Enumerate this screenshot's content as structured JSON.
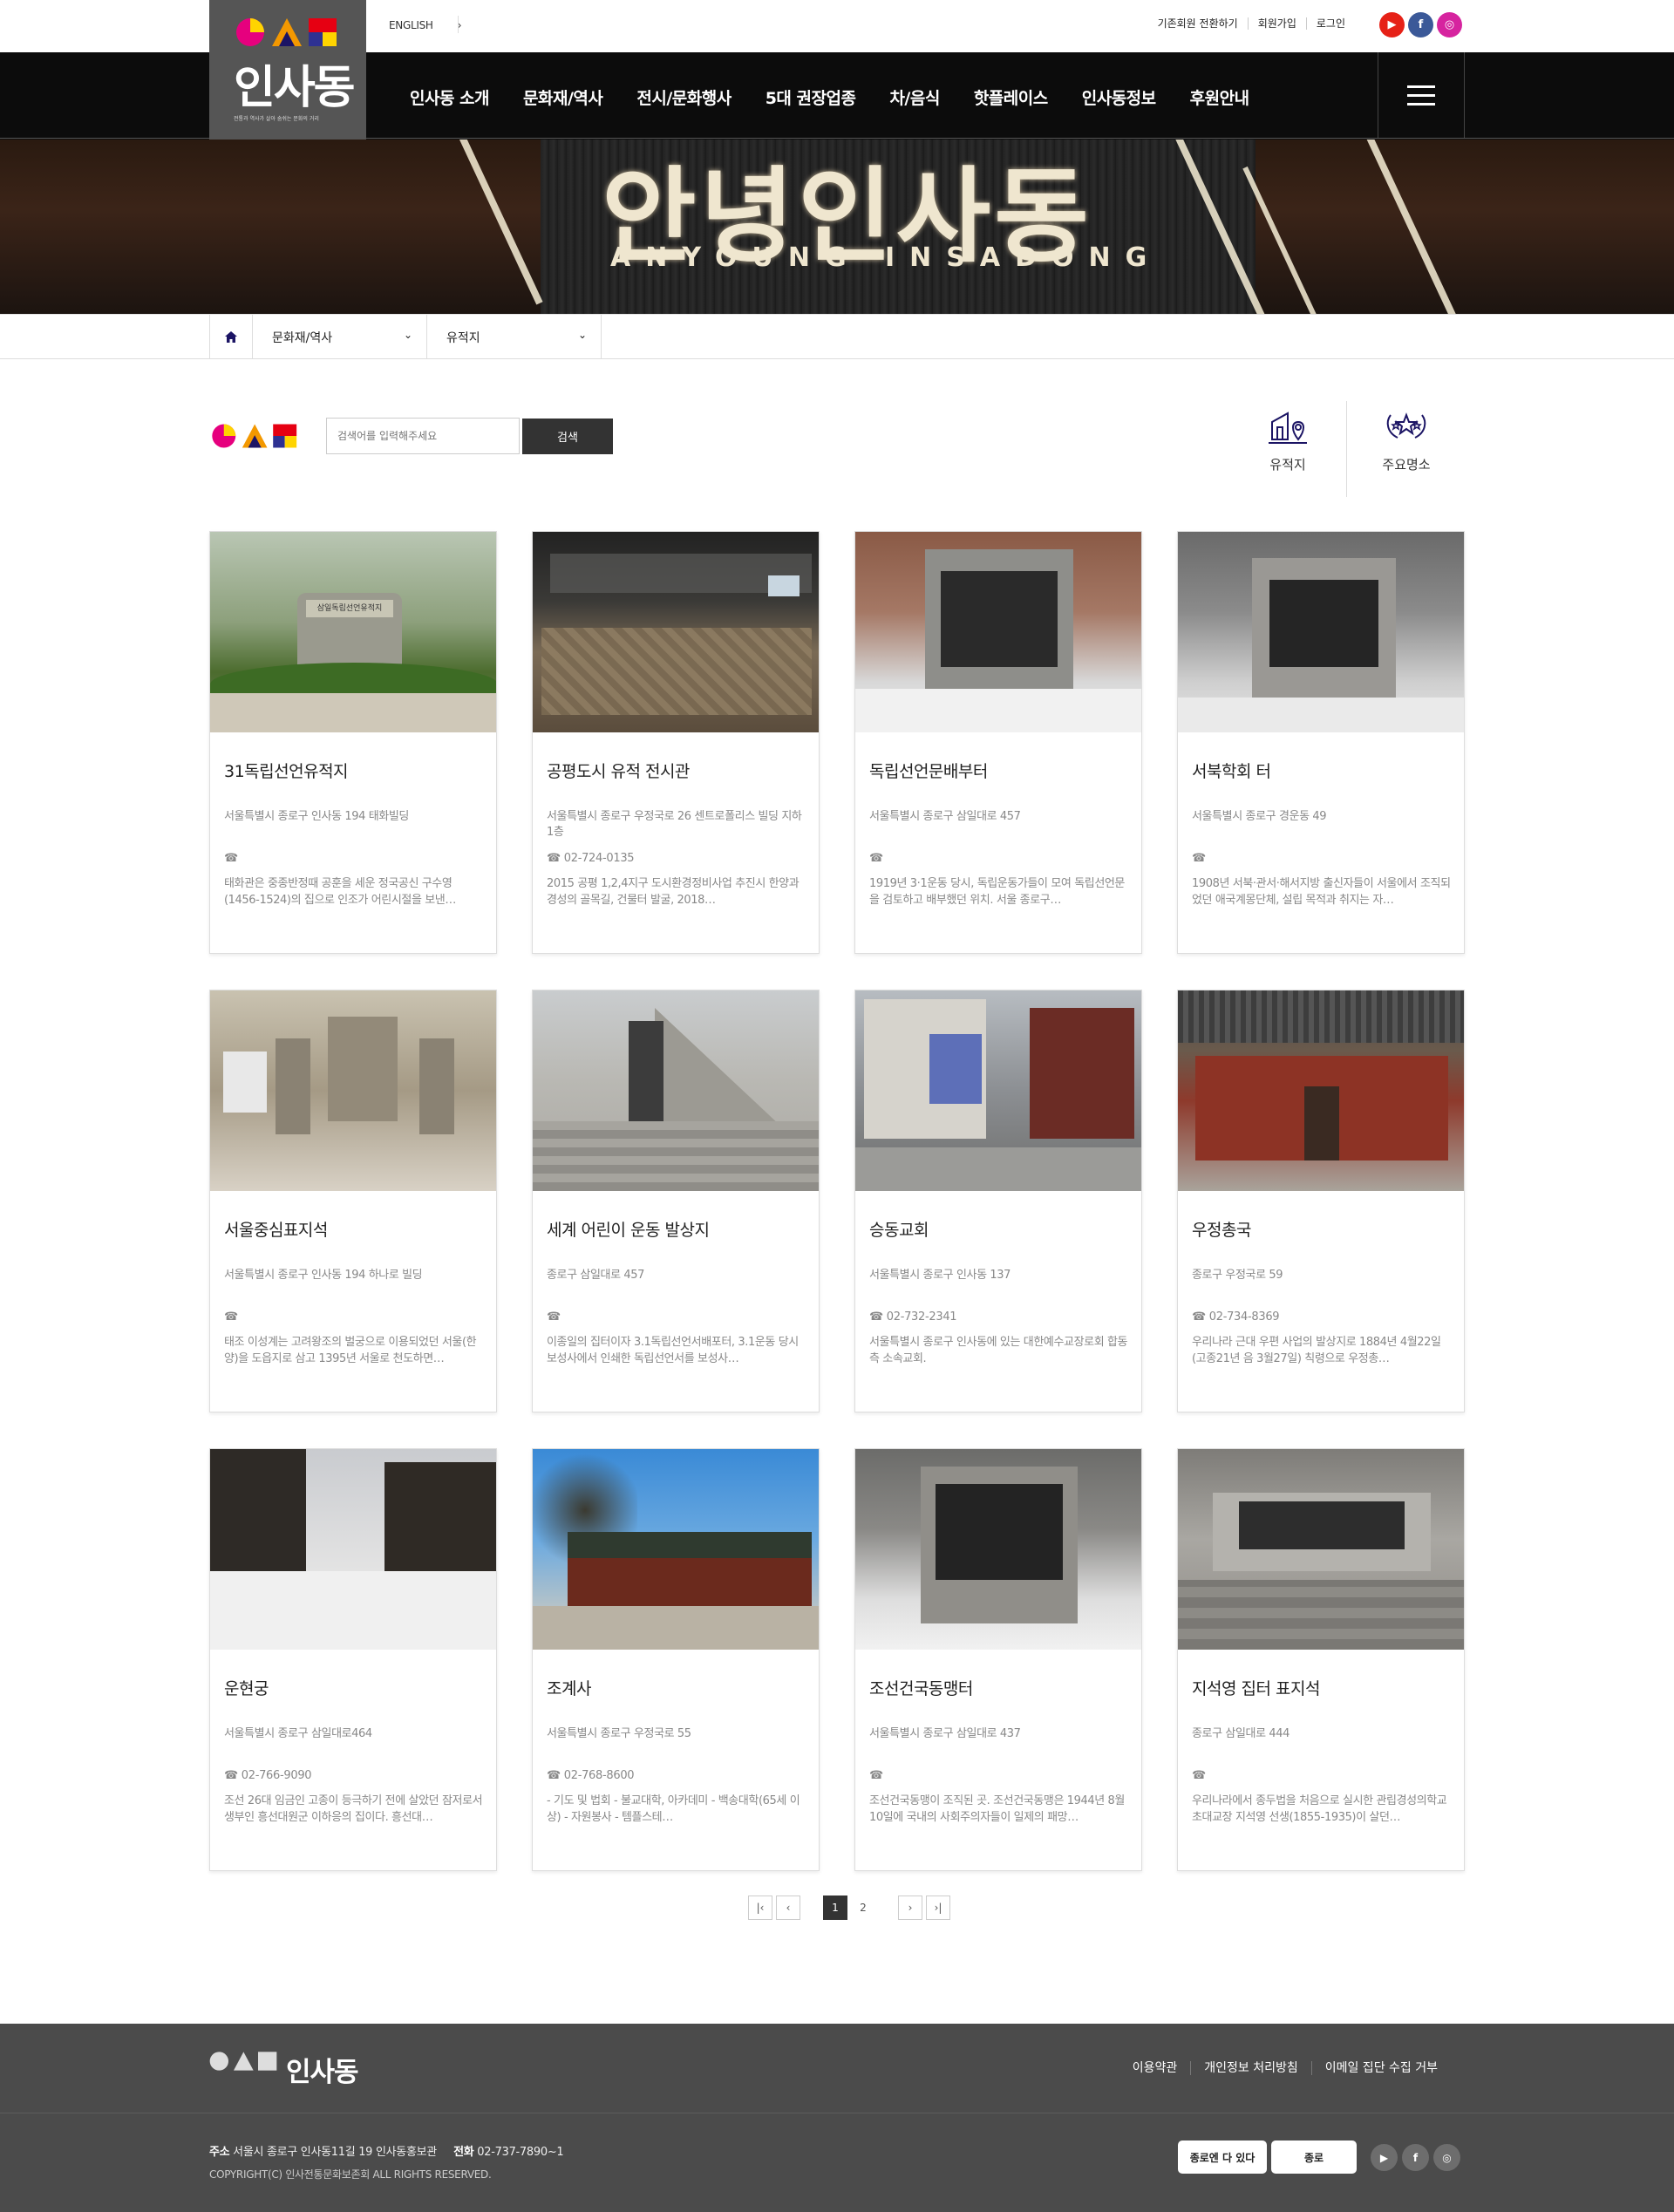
{
  "header": {
    "lang_label": "ENGLISH",
    "top_links": [
      "기존회원 전환하기",
      "회원가입",
      "로그인"
    ],
    "logo_name": "인사동",
    "logo_tagline": "전통과 역사가 살아 숨쉬는 문화의 거리",
    "nav": [
      "인사동 소개",
      "문화재/역사",
      "전시/문화행사",
      "5대 권장업종",
      "차/음식",
      "핫플레이스",
      "인사동정보",
      "후원안내"
    ],
    "sns_colors": {
      "youtube": "#e62117",
      "facebook": "#3b5998",
      "instagram": "#d6249f"
    }
  },
  "hero": {
    "title": "안녕인사동",
    "subtitle": "ANYOUNG INSADONG"
  },
  "breadcrumb": {
    "level1": "문화재/역사",
    "level2": "유적지"
  },
  "search": {
    "placeholder": "검색어를 입력해주세요",
    "button": "검색"
  },
  "categories": [
    "유적지",
    "주요명소"
  ],
  "cards": [
    {
      "title": "31독립선언유적지",
      "address": "서울특별시 종로구 인사동 194 태화빌딩",
      "tel": "",
      "desc": "태화관은 중종반정때 공훈을 세운 정국공신 구수영(1456-1524)의 집으로 인조가 어린시절을 보낸…"
    },
    {
      "title": "공평도시 유적 전시관",
      "address": "서울특별시 종로구 우정국로 26 센트로폴리스 빌딩 지하1층",
      "tel": "02-724-0135",
      "desc": "2015 공평 1,2,4지구 도시환경정비사업 추진시 한양과 경성의 골목길, 건물터 발굴, 2018…"
    },
    {
      "title": "독립선언문배부터",
      "address": "서울특별시 종로구 삼일대로 457",
      "tel": "",
      "desc": "1919년 3·1운동 당시, 독립운동가들이 모여 독립선언문을 검토하고 배부했던 위치. 서울 종로구…"
    },
    {
      "title": "서북학회 터",
      "address": "서울특별시 종로구 경운동 49",
      "tel": "",
      "desc": "1908년 서북·관서·해서지방 출신자들이 서울에서 조직되었던 애국계몽단체, 설립 목적과 취지는 자…"
    },
    {
      "title": "서울중심표지석",
      "address": "서울특별시 종로구 인사동 194 하나로 빌딩",
      "tel": "",
      "desc": "태조 이성계는 고려왕조의 벌궁으로 이용되었던 서울(한양)을 도읍지로 삼고 1395년 서울로 천도하면…"
    },
    {
      "title": "세계 어린이 운동 발상지",
      "address": "종로구 삼일대로 457",
      "tel": "",
      "desc": "이종일의 집터이자 3.1독립선언서배포터, 3.1운동 당시 보성사에서 인쇄한 독립선언서를 보성사…"
    },
    {
      "title": "승동교회",
      "address": "서울특별시 종로구 인사동 137",
      "tel": "02-732-2341",
      "desc": "서울특별시 종로구 인사동에 있는 대한예수교장로회 합동측 소속교회."
    },
    {
      "title": "우정총국",
      "address": "종로구 우정국로 59",
      "tel": "02-734-8369",
      "desc": "우리나라 근대 우편 사업의 발상지로 1884년 4월22일(고종21년 음 3월27일) 칙령으로 우정총…"
    },
    {
      "title": "운현궁",
      "address": "서울특별시 종로구 삼일대로464",
      "tel": "02-766-9090",
      "desc": "조선 26대 임금인 고종이 등극하기 전에 살았던 잠저로서 생부인 흥선대원군 이하응의 집이다. 흥선대…"
    },
    {
      "title": "조계사",
      "address": "서울특별시 종로구 우정국로 55",
      "tel": "02-768-8600",
      "desc": "- 기도 및 법회 - 불교대학, 아카데미 - 백송대학(65세 이상) - 자원봉사 - 템플스테…"
    },
    {
      "title": "조선건국동맹터",
      "address": "서울특별시 종로구 삼일대로 437",
      "tel": "",
      "desc": "조선건국동맹이 조직된 곳. 조선건국동맹은 1944년 8월 10일에 국내의 사회주의자들이 일제의 패망…"
    },
    {
      "title": "지석영 집터 표지석",
      "address": "종로구 삼일대로 444",
      "tel": "",
      "desc": "우리나라에서 종두법을 처음으로 실시한 관립경성의학교 초대교장 지석영 선생(1855-1935)이 살던…"
    }
  ],
  "pagination": {
    "pages": [
      "1",
      "2"
    ],
    "current": "1"
  },
  "footer": {
    "links": [
      "이용약관",
      "개인정보 처리방침",
      "이메일 집단 수집 거부"
    ],
    "addr_label": "주소",
    "addr": "서울시 종로구 인사동11길 19 인사동홍보관",
    "tel_label": "전화",
    "tel": "02-737-7890~1",
    "copyright": "COPYRIGHT(C) 인사전통문화보존회 ALL RIGHTS RESERVED.",
    "badge1": "종로엔 다 있다",
    "badge2": "종로"
  }
}
